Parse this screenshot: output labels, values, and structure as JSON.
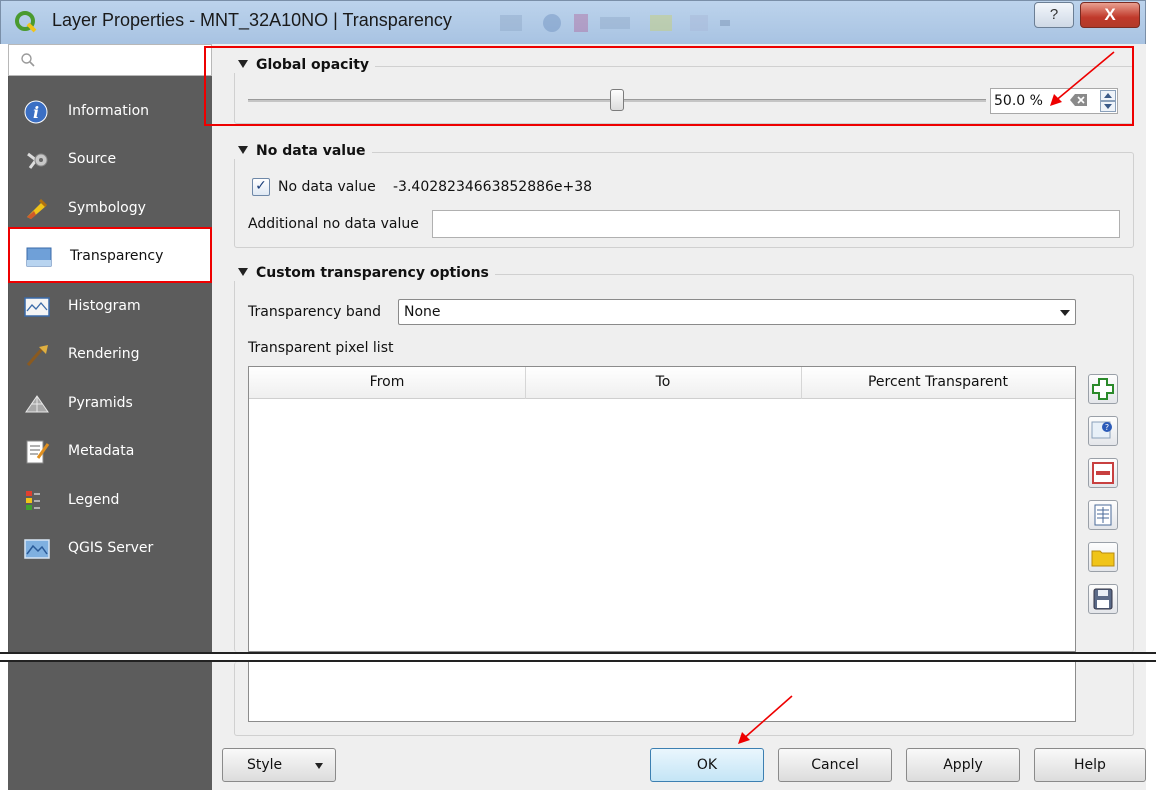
{
  "window": {
    "title": "Layer Properties - MNT_32A10NO | Transparency",
    "help_label": "?",
    "close_label": "X"
  },
  "sidebar": {
    "search_placeholder": "",
    "items": [
      {
        "label": "Information",
        "icon": "info-icon"
      },
      {
        "label": "Source",
        "icon": "source-icon"
      },
      {
        "label": "Symbology",
        "icon": "symbology-icon"
      },
      {
        "label": "Transparency",
        "icon": "transparency-icon",
        "active": true
      },
      {
        "label": "Histogram",
        "icon": "histogram-icon"
      },
      {
        "label": "Rendering",
        "icon": "rendering-icon"
      },
      {
        "label": "Pyramids",
        "icon": "pyramids-icon"
      },
      {
        "label": "Metadata",
        "icon": "metadata-icon"
      },
      {
        "label": "Legend",
        "icon": "legend-icon"
      },
      {
        "label": "QGIS Server",
        "icon": "qgis-server-icon"
      }
    ]
  },
  "global_opacity": {
    "title": "Global opacity",
    "value": 0.5,
    "value_label": "50.0 %"
  },
  "no_data": {
    "title": "No data value",
    "checkbox_label": "No data value",
    "checked": true,
    "value": "-3.4028234663852886e+38",
    "additional_label": "Additional no data value",
    "additional_value": ""
  },
  "custom": {
    "title": "Custom transparency options",
    "band_label": "Transparency band",
    "band_value": "None",
    "pixel_list_label": "Transparent pixel list",
    "columns": [
      "From",
      "To",
      "Percent Transparent"
    ],
    "tools": [
      "add-icon",
      "add-from-display-icon",
      "remove-icon",
      "default-values-icon",
      "import-icon",
      "save-icon"
    ]
  },
  "footer": {
    "style_label": "Style",
    "ok_label": "OK",
    "cancel_label": "Cancel",
    "apply_label": "Apply",
    "help_label": "Help"
  },
  "colors": {
    "sidebar": "#5c5c5c",
    "highlight": "#e00000",
    "ok_accent": "#3c7fb1"
  }
}
